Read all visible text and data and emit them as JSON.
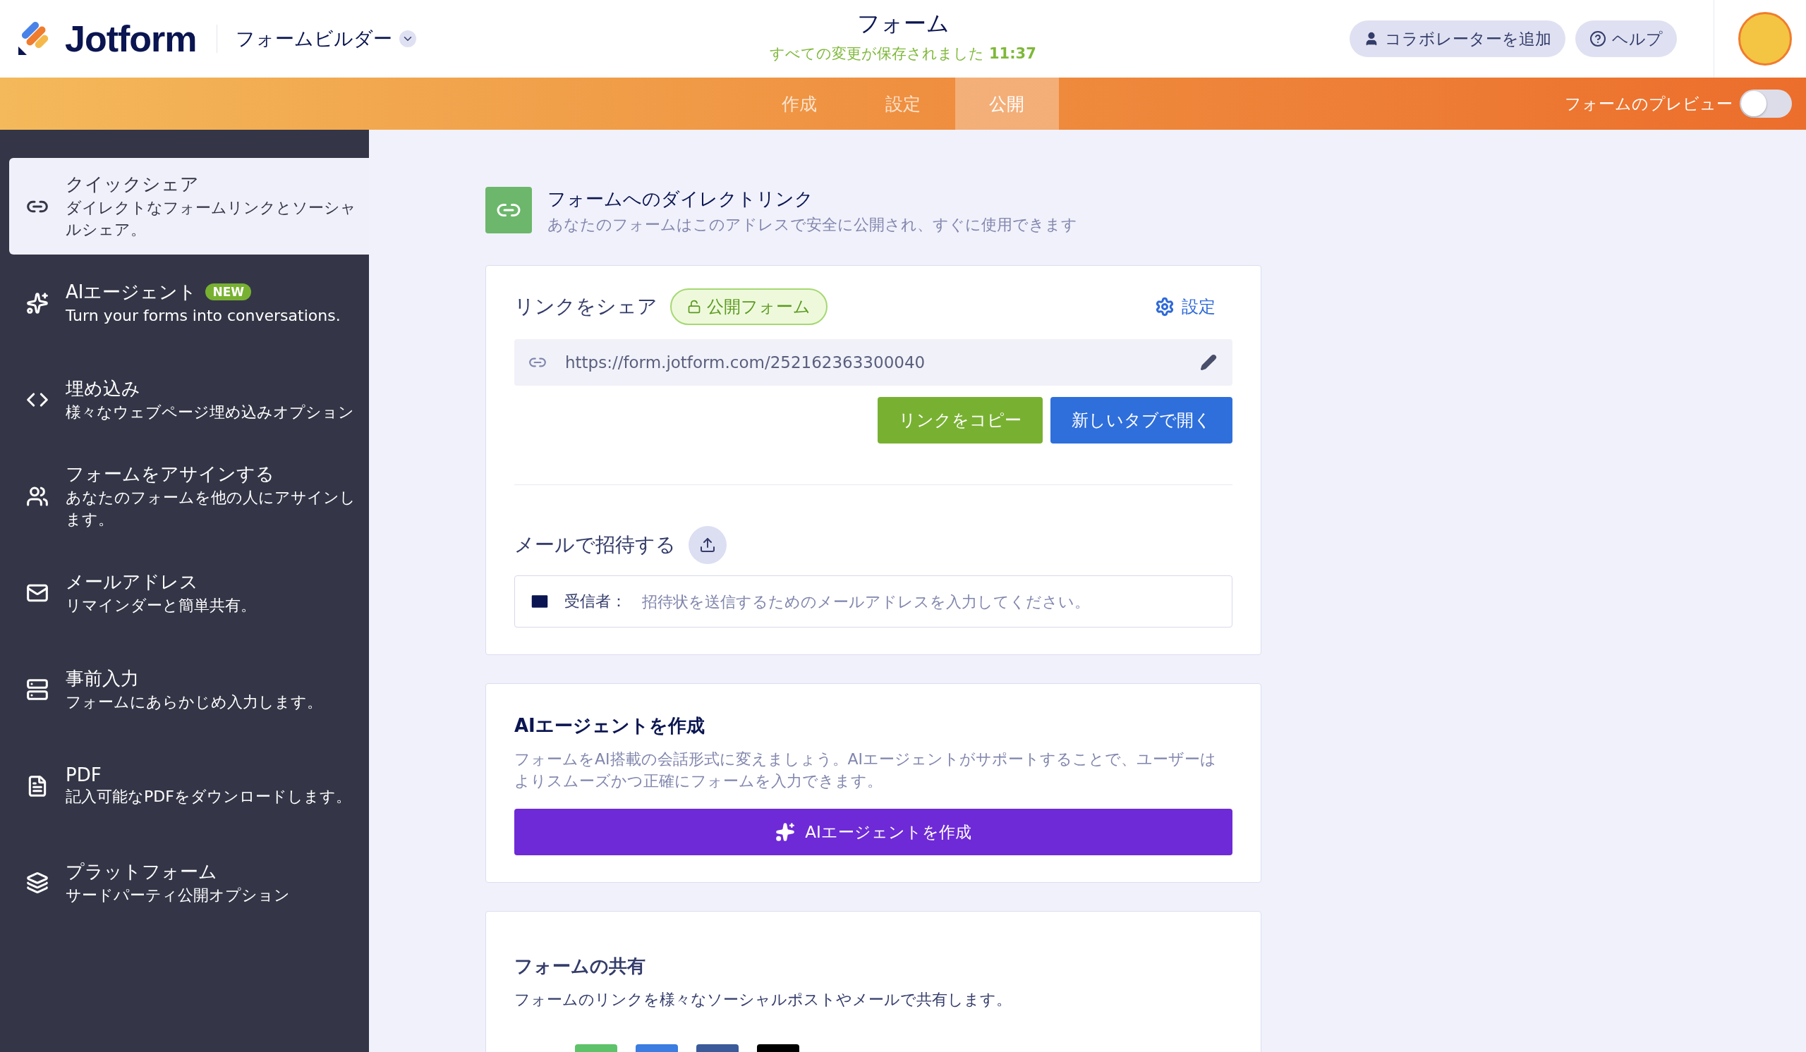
{
  "header": {
    "logo_text": "Jotform",
    "builder_menu": "フォームビルダー",
    "title": "フォーム",
    "save_status": "すべての変更が保存されました",
    "save_time": "11:37",
    "buttons": [
      {
        "label": "コラボレーターを追加",
        "kind": "user"
      },
      {
        "label": "ヘルプ",
        "kind": "help"
      }
    ]
  },
  "tabs": [
    {
      "label": "作成",
      "selected": false
    },
    {
      "label": "設定",
      "selected": false
    },
    {
      "label": "公開",
      "selected": true
    }
  ],
  "preview": {
    "label": "フォームのプレビュー",
    "on": false
  },
  "sidebar": {
    "items": [
      {
        "title": "クイックシェア",
        "description": "ダイレクトなフォームリンクとソーシャルシェア。",
        "selected": true
      },
      {
        "title": "AIエージェント",
        "badge": "NEW",
        "description": "Turn your forms into conversations.",
        "selected": false
      },
      {
        "title": "埋め込み",
        "description": "様々なウェブページ埋め込みオプション",
        "selected": false
      },
      {
        "title": "フォームをアサインする",
        "description": "あなたのフォームを他の人にアサインします。",
        "selected": false
      },
      {
        "title": "メールアドレス",
        "description": "リマインダーと簡単共有。",
        "selected": false
      },
      {
        "title": "事前入力",
        "description": "フォームにあらかじめ入力します。",
        "selected": false
      },
      {
        "title": "PDF",
        "description": "記入可能なPDFをダウンロードします。",
        "selected": false
      },
      {
        "title": "プラットフォーム",
        "description": "サードパーティ公開オプション",
        "selected": false
      }
    ]
  },
  "direct_link": {
    "title": "フォームへのダイレクトリンク",
    "subtitle": "あなたのフォームはこのアドレスで安全に公開され、すぐに使用できます"
  },
  "share_link": {
    "heading": "リンクをシェア",
    "badge": "公開フォーム",
    "settings": "設定",
    "url": "https://form.jotform.com/252162363300040",
    "copy_button": "リンクをコピー",
    "open_button": "新しいタブで開く"
  },
  "invite": {
    "heading": "メールで招待する",
    "recipient_label": "受信者：",
    "placeholder": "招待状を送信するためのメールアドレスを入力してください。"
  },
  "ai_agent": {
    "heading": "AIエージェントを作成",
    "description": "フォームをAI搭載の会話形式に変えましょう。AIエージェントがサポートすることで、ユーザーはよりスムーズかつ正確にフォームを入力できます。",
    "button": "AIエージェントを作成"
  },
  "form_sharing": {
    "heading": "フォームの共有",
    "description": "フォームのリンクを様々なソーシャルポストやメールで共有します。",
    "share_buttons": [
      {
        "color": "#5ec26a"
      },
      {
        "color": "#3b7de0"
      },
      {
        "color": "#3b5a9a"
      },
      {
        "color": "#000000"
      }
    ]
  }
}
